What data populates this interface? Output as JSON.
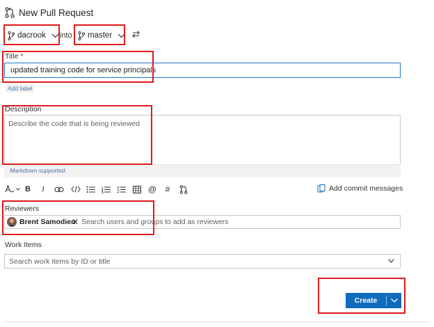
{
  "header": {
    "title": "New Pull Request",
    "icon": "pull-request-icon"
  },
  "branches": {
    "source": "dacrook",
    "joiner": "into",
    "target": "master"
  },
  "title_field": {
    "label": "Title",
    "required_marker": "*",
    "value": "updated training code for service principals"
  },
  "add_label": "Add label",
  "description": {
    "label": "Description",
    "placeholder": "Describe the code that is being reviewed",
    "markdown_note": "Markdown supported."
  },
  "toolbar": {
    "items": [
      "format-text-icon",
      "bold-icon",
      "italic-icon",
      "link-icon",
      "code-icon",
      "bullet-list-icon",
      "numbered-list-icon",
      "checklist-icon",
      "table-icon",
      "mention-icon",
      "hashtag-icon",
      "pull-request-link-icon"
    ],
    "bold": "B",
    "italic": "I",
    "mention": "@",
    "hashtag": "#",
    "add_commit_messages": "Add commit messages"
  },
  "reviewers": {
    "label": "Reviewers",
    "selected": "Brent Samodien",
    "remove": "✕",
    "placeholder": "Search users and groups to add as reviewers"
  },
  "work_items": {
    "label": "Work Items",
    "placeholder": "Search work items by ID or title"
  },
  "create_button": {
    "label": "Create"
  },
  "colors": {
    "accent": "#0f6cbd",
    "highlight": "#e0191a"
  }
}
